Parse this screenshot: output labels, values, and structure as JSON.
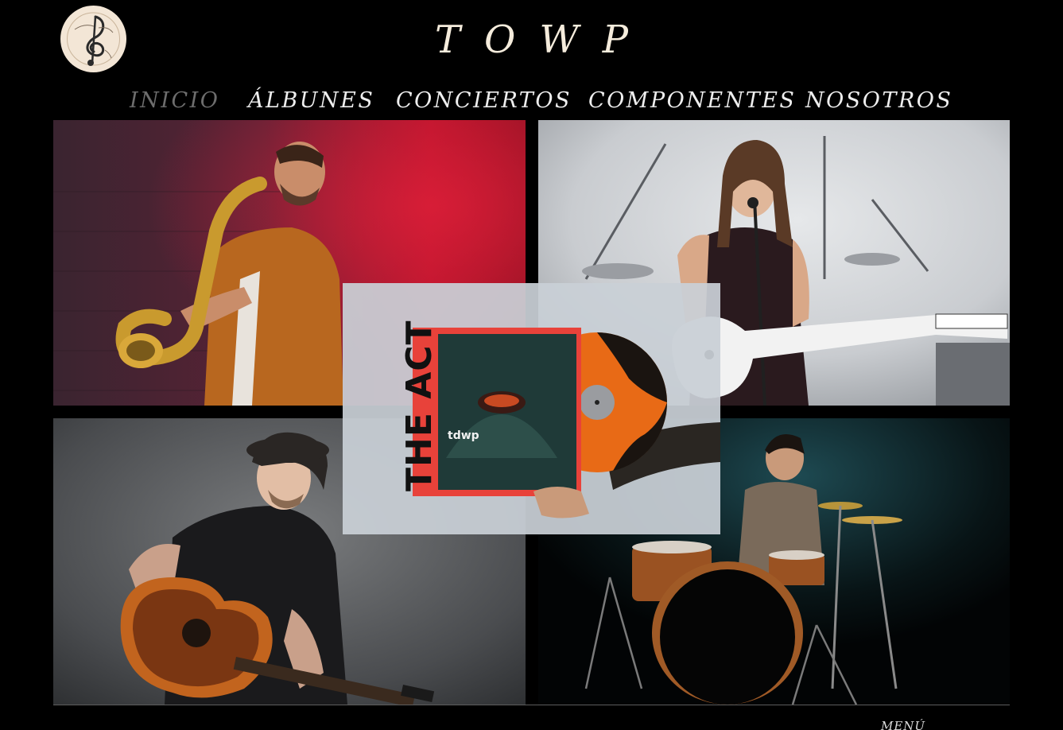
{
  "site": {
    "title": "TOWP",
    "logo_icon": "treble-clef-logo-icon"
  },
  "nav": {
    "items": [
      {
        "label": "INICIO",
        "active": true
      },
      {
        "label": "ÁLBUNES",
        "active": false
      },
      {
        "label": "CONCIERTOS",
        "active": false
      },
      {
        "label": "COMPONENTES",
        "active": false
      },
      {
        "label": "NOSOTROS",
        "active": false
      }
    ]
  },
  "gallery": {
    "photos": [
      {
        "subject": "saxophone-player-photo"
      },
      {
        "subject": "singer-guitarist-photo"
      },
      {
        "subject": "acoustic-guitarist-photo"
      },
      {
        "subject": "drummer-photo"
      }
    ],
    "album": {
      "subject": "album-vinyl-photo",
      "cover_title": "THE ACT",
      "cover_band": "tdwp"
    }
  },
  "footer": {
    "menu_label": "MENÚ"
  },
  "colors": {
    "background": "#000000",
    "title": "#f5ecdc",
    "nav_text": "#eeeeee",
    "nav_active": "#6d6d6d",
    "album_red": "#e8423a",
    "vinyl_orange": "#e86a16"
  }
}
